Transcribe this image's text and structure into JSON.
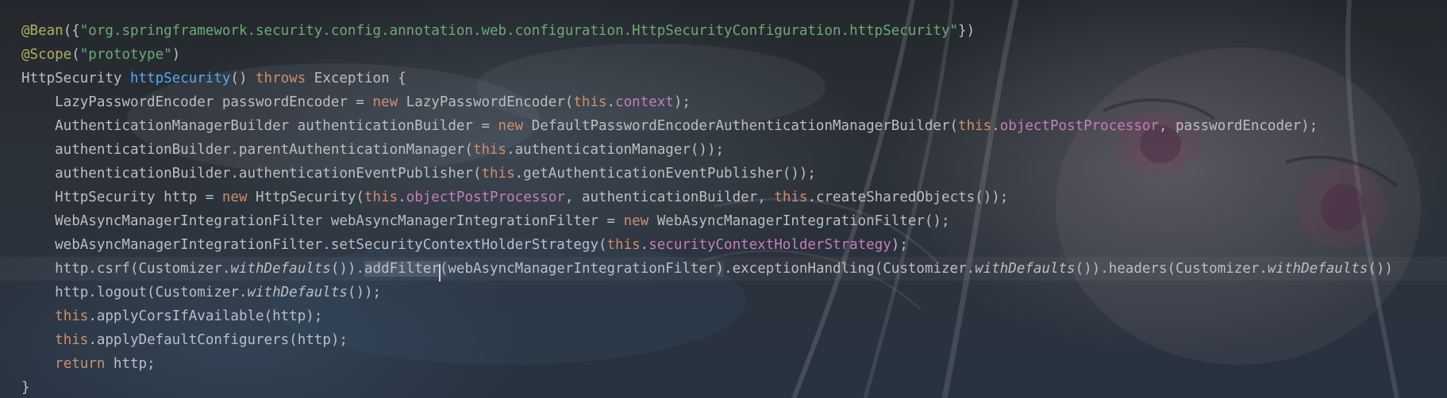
{
  "editor": {
    "colors": {
      "annotation": "#b3ae60",
      "string": "#6aab73",
      "keyword": "#cf8e6d",
      "field": "#c77dbb",
      "method_decl": "#56a8f5",
      "text": "#bcbec4"
    },
    "lines": [
      {
        "tokens": [
          {
            "t": "@Bean",
            "c": "ann"
          },
          {
            "t": "({",
            "c": "plain"
          },
          {
            "t": "\"org.springframework.security.config.annotation.web.configuration.HttpSecurityConfiguration.httpSecurity\"",
            "c": "str"
          },
          {
            "t": "})",
            "c": "plain"
          }
        ]
      },
      {
        "tokens": [
          {
            "t": "@Scope",
            "c": "ann"
          },
          {
            "t": "(",
            "c": "plain"
          },
          {
            "t": "\"prototype\"",
            "c": "str"
          },
          {
            "t": ")",
            "c": "plain"
          }
        ]
      },
      {
        "tokens": [
          {
            "t": "HttpSecurity ",
            "c": "plain"
          },
          {
            "t": "httpSecurity",
            "c": "fn"
          },
          {
            "t": "() ",
            "c": "plain"
          },
          {
            "t": "throws ",
            "c": "kw"
          },
          {
            "t": "Exception {",
            "c": "plain"
          }
        ]
      },
      {
        "tokens": [
          {
            "t": "    LazyPasswordEncoder passwordEncoder = ",
            "c": "plain"
          },
          {
            "t": "new ",
            "c": "kw"
          },
          {
            "t": "LazyPasswordEncoder(",
            "c": "plain"
          },
          {
            "t": "this",
            "c": "kw"
          },
          {
            "t": ".",
            "c": "plain"
          },
          {
            "t": "context",
            "c": "fld"
          },
          {
            "t": ");",
            "c": "plain"
          }
        ]
      },
      {
        "tokens": [
          {
            "t": "    AuthenticationManagerBuilder authenticationBuilder = ",
            "c": "plain"
          },
          {
            "t": "new ",
            "c": "kw"
          },
          {
            "t": "DefaultPasswordEncoderAuthenticationManagerBuilder(",
            "c": "plain"
          },
          {
            "t": "this",
            "c": "kw"
          },
          {
            "t": ".",
            "c": "plain"
          },
          {
            "t": "objectPostProcessor",
            "c": "fld"
          },
          {
            "t": ", passwordEncoder);",
            "c": "plain"
          }
        ]
      },
      {
        "tokens": [
          {
            "t": "    authenticationBuilder.parentAuthenticationManager(",
            "c": "plain"
          },
          {
            "t": "this",
            "c": "kw"
          },
          {
            "t": ".authenticationManager());",
            "c": "plain"
          }
        ]
      },
      {
        "tokens": [
          {
            "t": "    authenticationBuilder.authenticationEventPublisher(",
            "c": "plain"
          },
          {
            "t": "this",
            "c": "kw"
          },
          {
            "t": ".getAuthenticationEventPublisher());",
            "c": "plain"
          }
        ]
      },
      {
        "tokens": [
          {
            "t": "    HttpSecurity http = ",
            "c": "plain"
          },
          {
            "t": "new ",
            "c": "kw"
          },
          {
            "t": "HttpSecurity(",
            "c": "plain"
          },
          {
            "t": "this",
            "c": "kw"
          },
          {
            "t": ".",
            "c": "plain"
          },
          {
            "t": "objectPostProcessor",
            "c": "fld"
          },
          {
            "t": ", authenticationBuilder, ",
            "c": "plain"
          },
          {
            "t": "this",
            "c": "kw"
          },
          {
            "t": ".createSharedObjects());",
            "c": "plain"
          }
        ]
      },
      {
        "tokens": [
          {
            "t": "    WebAsyncManagerIntegrationFilter webAsyncManagerIntegrationFilter = ",
            "c": "plain"
          },
          {
            "t": "new ",
            "c": "kw"
          },
          {
            "t": "WebAsyncManagerIntegrationFilter();",
            "c": "plain"
          }
        ]
      },
      {
        "tokens": [
          {
            "t": "    webAsyncManagerIntegrationFilter.setSecurityContextHolderStrategy(",
            "c": "plain"
          },
          {
            "t": "this",
            "c": "kw"
          },
          {
            "t": ".",
            "c": "plain"
          },
          {
            "t": "securityContextHolderStrategy",
            "c": "fld"
          },
          {
            "t": ");",
            "c": "plain"
          }
        ]
      },
      {
        "current": true,
        "tokens": [
          {
            "t": "    http.csrf(Customizer.",
            "c": "plain"
          },
          {
            "t": "withDefaults",
            "c": "ital"
          },
          {
            "t": "()).",
            "c": "plain"
          },
          {
            "t": "addFilter",
            "c": "usage"
          },
          {
            "t": "(",
            "c": "brace",
            "caret": true
          },
          {
            "t": "webAsyncManagerIntegrationFilter",
            "c": "plain"
          },
          {
            "t": ")",
            "c": "brace"
          },
          {
            "t": ".exceptionHandling(Customizer.",
            "c": "plain"
          },
          {
            "t": "withDefaults",
            "c": "ital"
          },
          {
            "t": "()).headers(Customizer.",
            "c": "plain"
          },
          {
            "t": "withDefaults",
            "c": "ital"
          },
          {
            "t": "())",
            "c": "plain"
          }
        ]
      },
      {
        "tokens": [
          {
            "t": "    http.logout(Customizer.",
            "c": "plain"
          },
          {
            "t": "withDefaults",
            "c": "ital"
          },
          {
            "t": "());",
            "c": "plain"
          }
        ]
      },
      {
        "tokens": [
          {
            "t": "    ",
            "c": "plain"
          },
          {
            "t": "this",
            "c": "kw"
          },
          {
            "t": ".applyCorsIfAvailable(http);",
            "c": "plain"
          }
        ]
      },
      {
        "tokens": [
          {
            "t": "    ",
            "c": "plain"
          },
          {
            "t": "this",
            "c": "kw"
          },
          {
            "t": ".applyDefaultConfigurers(http);",
            "c": "plain"
          }
        ]
      },
      {
        "tokens": [
          {
            "t": "    ",
            "c": "plain"
          },
          {
            "t": "return ",
            "c": "kw"
          },
          {
            "t": "http;",
            "c": "plain"
          }
        ]
      },
      {
        "tokens": [
          {
            "t": "}",
            "c": "plain"
          }
        ]
      }
    ]
  }
}
